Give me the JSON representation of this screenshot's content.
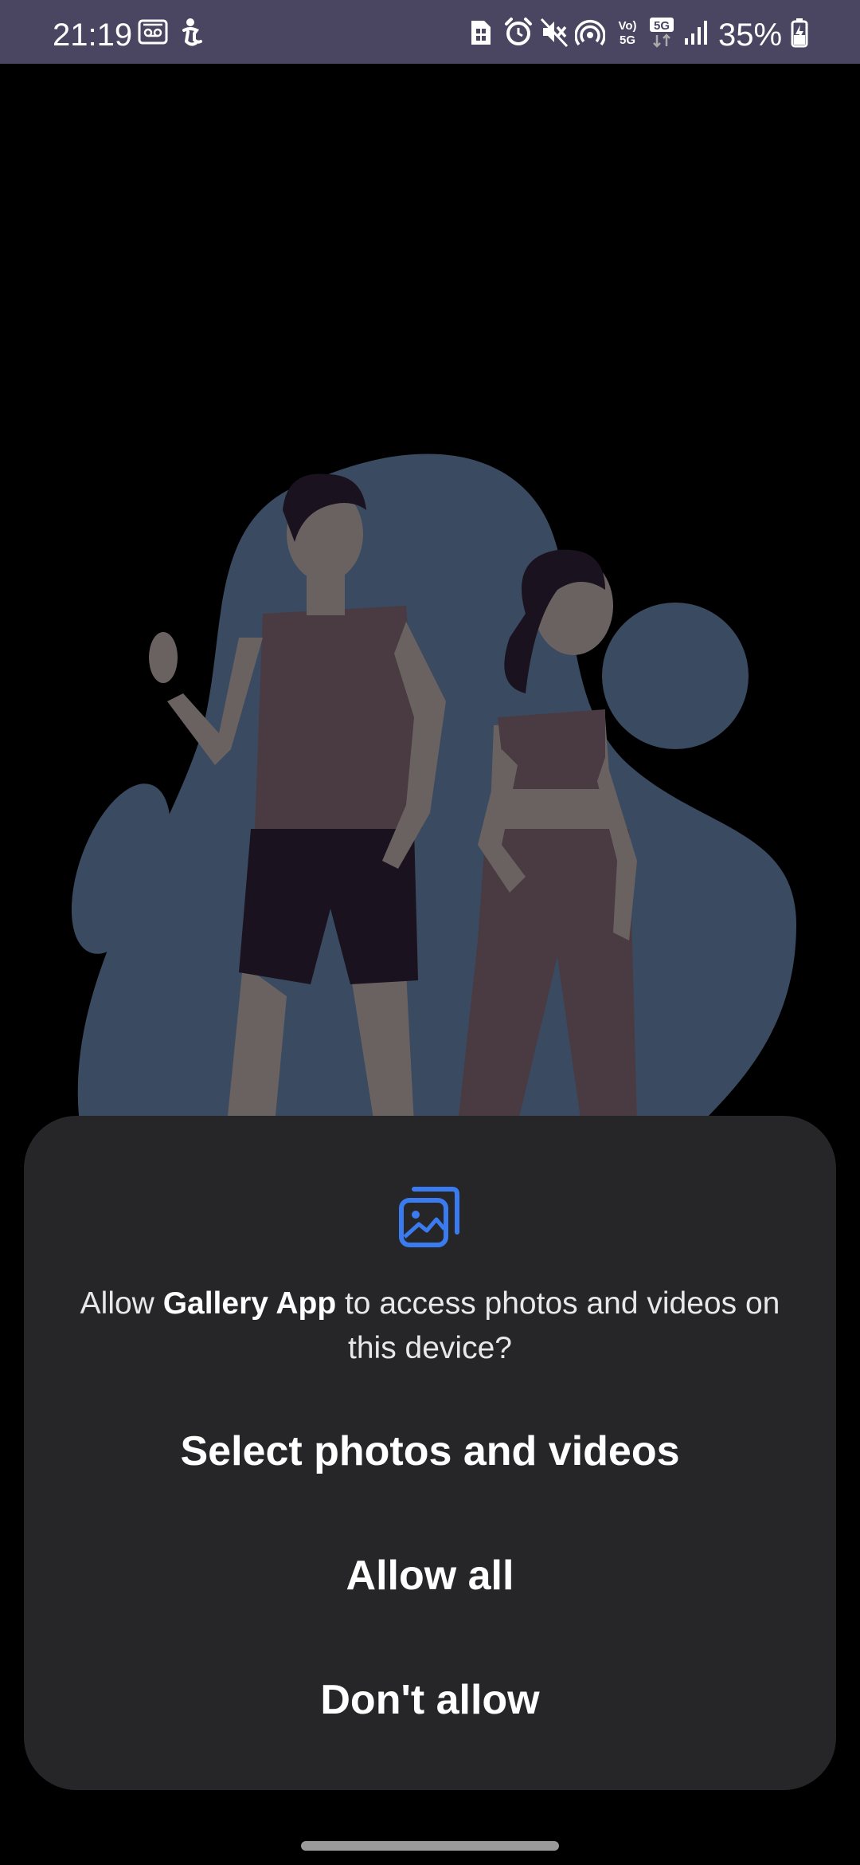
{
  "status_bar": {
    "time": "21:19",
    "battery_percent": "35%",
    "network_type": "5G",
    "icons": [
      "voicemail-icon",
      "accessibility-icon",
      "sim-icon",
      "alarm-icon",
      "mute-icon",
      "hotspot-icon",
      "volte-icon",
      "5g-icon",
      "signal-icon",
      "battery-charging-icon"
    ]
  },
  "illustration": {
    "description_icon": "fitness-couple-illustration"
  },
  "dialog": {
    "icon": "gallery-icon",
    "message_prefix": "Allow ",
    "app_name": "Gallery App",
    "message_suffix": " to access photos and videos on this device?",
    "buttons": {
      "select": "Select photos and videos",
      "allow_all": "Allow all",
      "deny": "Don't allow"
    }
  },
  "colors": {
    "status_bar_bg": "#4a4560",
    "sheet_bg": "#262628",
    "accent": "#3a7bf0",
    "blob": "#3a4a60"
  }
}
